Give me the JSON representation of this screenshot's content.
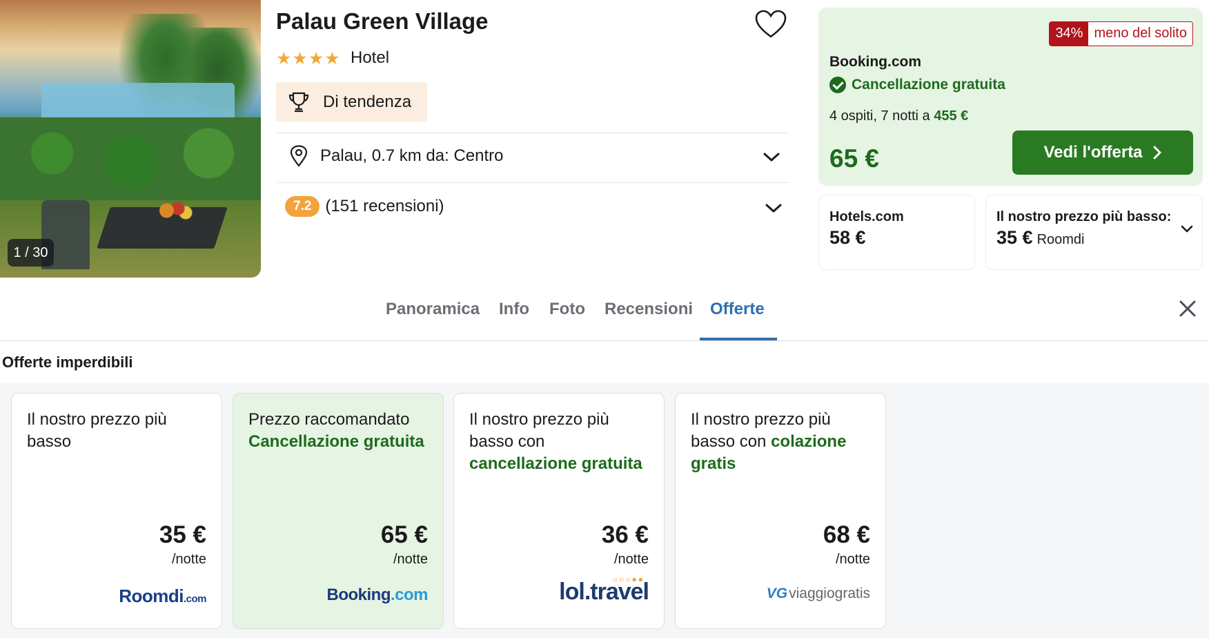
{
  "photo": {
    "counter": "1 / 30"
  },
  "hotel": {
    "name": "Palau Green Village",
    "stars": "★★★★",
    "type": "Hotel",
    "badge": "Di tendenza",
    "location": "Palau, 0.7 km da: Centro",
    "score": "7.2",
    "reviews": "(151 recensioni)"
  },
  "offer": {
    "discount_pct": "34%",
    "discount_text": "meno del solito",
    "provider": "Booking.com",
    "cancellation": "Cancellazione gratuita",
    "stay_prefix": "4 ospiti, 7 notti a",
    "stay_total": "455 €",
    "price": "65 €",
    "cta": "Vedi l'offerta"
  },
  "alternatives": [
    {
      "name": "Hotels.com",
      "price": "58 €"
    },
    {
      "name": "Il nostro prezzo più basso:",
      "price": "35 €",
      "source": "Roomdi"
    }
  ],
  "tabs": [
    "Panoramica",
    "Info",
    "Foto",
    "Recensioni",
    "Offerte"
  ],
  "active_tab": "Offerte",
  "section_title": "Offerte imperdibili",
  "deals": [
    {
      "line1": "Il nostro prezzo più basso",
      "price": "35 €",
      "per": "/notte",
      "logo_main": "Roomdi",
      "logo_suffix": ".com"
    },
    {
      "line1": "Prezzo raccomandato",
      "line2": "Cancellazione gratuita",
      "price": "65 €",
      "per": "/notte",
      "logo_main": "Booking",
      "logo_suffix": ".com"
    },
    {
      "line1": "Il nostro prezzo più basso con",
      "line2": "cancellazione gratuita",
      "price": "36 €",
      "per": "/notte",
      "logo_main": "lol.travel",
      "logo_dots": "○○○●●"
    },
    {
      "line1": "Il nostro prezzo più basso con",
      "line2": "colazione gratis",
      "price": "68 €",
      "per": "/notte",
      "logo_mark": "VG",
      "logo_main": "viaggiogratis"
    }
  ],
  "colors": {
    "accent_green": "#2a7a23",
    "price_green": "#1d6b1d",
    "offer_bg": "#e6f4e3",
    "tab_active": "#2f6fb0",
    "discount_red": "#b2131b",
    "star": "#f1a93a",
    "score_pill": "#f2a33c"
  },
  "icons": [
    "heart-icon",
    "trophy-icon",
    "map-pin-icon",
    "chevron-down-icon",
    "check-circle-icon",
    "chevron-right-icon",
    "close-icon"
  ]
}
